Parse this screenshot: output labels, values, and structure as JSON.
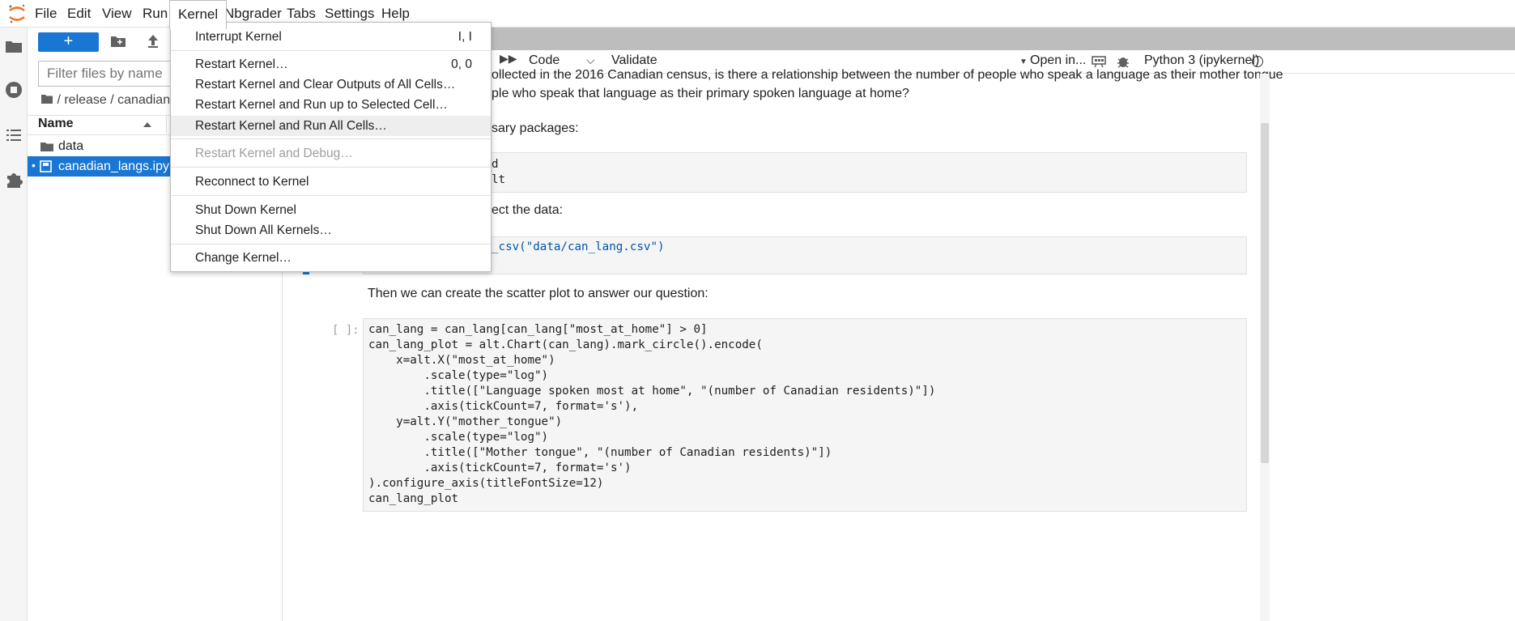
{
  "menubar": {
    "items": [
      "File",
      "Edit",
      "View",
      "Run",
      "Kernel",
      "Nbgrader",
      "Tabs",
      "Settings",
      "Help"
    ],
    "active": "Kernel"
  },
  "kernel_menu": {
    "items": [
      {
        "label": "Interrupt Kernel",
        "shortcut": "I, I"
      },
      {
        "label": "Restart Kernel…",
        "shortcut": "0, 0"
      },
      {
        "label": "Restart Kernel and Clear Outputs of All Cells…",
        "shortcut": ""
      },
      {
        "label": "Restart Kernel and Run up to Selected Cell…",
        "shortcut": ""
      },
      {
        "label": "Restart Kernel and Run All Cells…",
        "shortcut": ""
      },
      {
        "label": "Restart Kernel and Debug…",
        "shortcut": ""
      },
      {
        "label": "Reconnect to Kernel",
        "shortcut": ""
      },
      {
        "label": "Shut Down Kernel",
        "shortcut": ""
      },
      {
        "label": "Shut Down All Kernels…",
        "shortcut": ""
      },
      {
        "label": "Change Kernel…",
        "shortcut": ""
      }
    ]
  },
  "filebrowser": {
    "new_label": "+",
    "filter_placeholder": "Filter files by name",
    "breadcrumb": "/ release / canadian_la",
    "name_header": "Name",
    "files": [
      {
        "name": "data",
        "type": "folder"
      },
      {
        "name": "canadian_langs.ipynb",
        "type": "notebook"
      }
    ]
  },
  "notebook_toolbar": {
    "cell_type": "Code",
    "validate": "Validate",
    "open_in": "Open in...",
    "kernel": "Python 3 (ipykernel)"
  },
  "notebook": {
    "md1_line1": "ollected in the 2016 Canadian census, is there a relationship between the number of people who speak a language as their mother tongue",
    "md1_line2": "ple who speak that language as their primary spoken language at home?",
    "md2": "sary packages:",
    "code1_line1": "d",
    "code1_line2": "lt",
    "md3": "ect the data:",
    "code2_line1": "_csv(\"data/can_lang.csv\")",
    "md4": "Then we can create the scatter plot to answer our question:",
    "prompt": "[ ]:",
    "code3": [
      "can_lang = can_lang[can_lang[\"most_at_home\"] > 0]",
      "can_lang_plot = alt.Chart(can_lang).mark_circle().encode(",
      "    x=alt.X(\"most_at_home\")",
      "        .scale(type=\"log\")",
      "        .title([\"Language spoken most at home\", \"(number of Canadian residents)\"])",
      "        .axis(tickCount=7, format='s'),",
      "    y=alt.Y(\"mother_tongue\")",
      "        .scale(type=\"log\")",
      "        .title([\"Mother tongue\", \"(number of Canadian residents)\"])",
      "        .axis(tickCount=7, format='s')",
      ").configure_axis(titleFontSize=12)",
      "can_lang_plot"
    ]
  },
  "colors": {
    "accent": "#1976d2",
    "menu_hover": "#eeeeee",
    "selected_file": "#1976d2"
  }
}
